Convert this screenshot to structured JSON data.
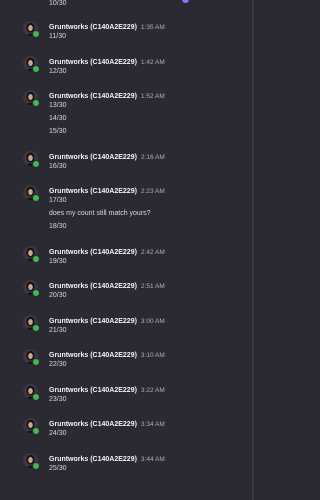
{
  "colors": {
    "background": "#2b2a33",
    "username": "#f2f2f4",
    "timestamp": "#b0aeb8",
    "message_text": "#d8d8dc",
    "online_status": "#3fb950",
    "accent": "#9b6bff"
  },
  "top_message": "10/30",
  "groups": [
    {
      "author": "Gruntworks (C140A2E229)",
      "time": "1:35 AM",
      "messages": [
        "11/30"
      ]
    },
    {
      "author": "Gruntworks (C140A2E229)",
      "time": "1:42 AM",
      "messages": [
        "12/30"
      ]
    },
    {
      "author": "Gruntworks (C140A2E229)",
      "time": "1:52 AM",
      "messages": [
        "13/30",
        "14/30",
        "15/30"
      ]
    },
    {
      "author": "Gruntworks (C140A2E229)",
      "time": "2:16 AM",
      "messages": [
        "16/30"
      ]
    },
    {
      "author": "Gruntworks (C140A2E229)",
      "time": "2:23 AM",
      "messages": [
        "17/30",
        "does my count still match yours?",
        "18/30"
      ]
    },
    {
      "author": "Gruntworks (C140A2E229)",
      "time": "2:42 AM",
      "messages": [
        "19/30"
      ]
    },
    {
      "author": "Gruntworks (C140A2E229)",
      "time": "2:51 AM",
      "messages": [
        "20/30"
      ]
    },
    {
      "author": "Gruntworks (C140A2E229)",
      "time": "3:00 AM",
      "messages": [
        "21/30"
      ]
    },
    {
      "author": "Gruntworks (C140A2E229)",
      "time": "3:10 AM",
      "messages": [
        "22/30"
      ]
    },
    {
      "author": "Gruntworks (C140A2E229)",
      "time": "3:22 AM",
      "messages": [
        "23/30"
      ]
    },
    {
      "author": "Gruntworks (C140A2E229)",
      "time": "3:34 AM",
      "messages": [
        "24/30"
      ]
    },
    {
      "author": "Gruntworks (C140A2E229)",
      "time": "3:44 AM",
      "messages": [
        "25/30"
      ]
    }
  ]
}
